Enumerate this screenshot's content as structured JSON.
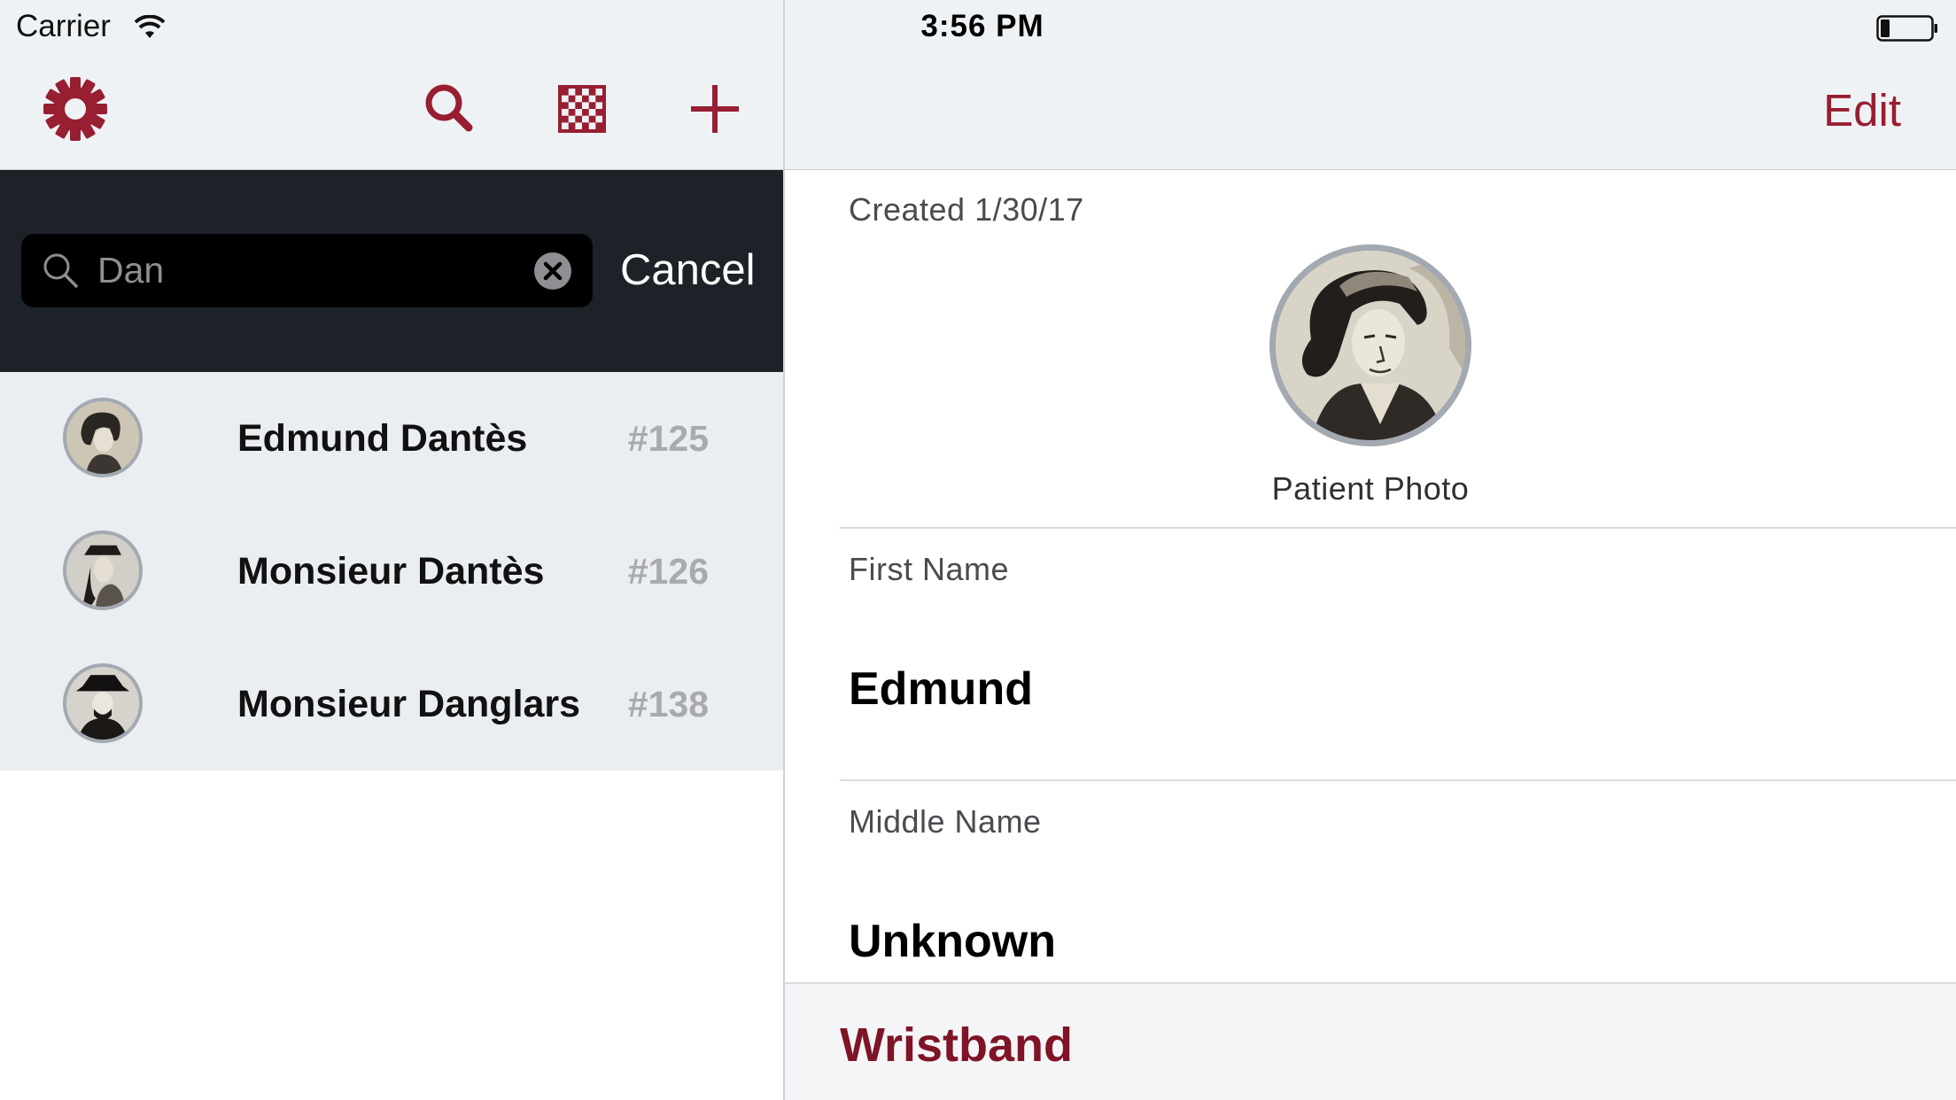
{
  "status_bar": {
    "carrier": "Carrier",
    "time": "3:56 PM"
  },
  "left_toolbar": {
    "icons": [
      "gear-icon",
      "search-icon",
      "checkerboard-icon",
      "plus-icon"
    ],
    "accent_color": "#981e32"
  },
  "search": {
    "value": "Dan",
    "cancel_label": "Cancel"
  },
  "results": [
    {
      "name": "Edmund Dantès",
      "number": "#125"
    },
    {
      "name": "Monsieur Dantès",
      "number": "#126"
    },
    {
      "name": "Monsieur Danglars",
      "number": "#138"
    }
  ],
  "detail": {
    "edit_label": "Edit",
    "created": "Created 1/30/17",
    "photo_caption": "Patient Photo",
    "first_name_label": "First Name",
    "first_name_value": "Edmund",
    "middle_name_label": "Middle Name",
    "middle_name_value": "Unknown",
    "wristband_title": "Wristband"
  }
}
